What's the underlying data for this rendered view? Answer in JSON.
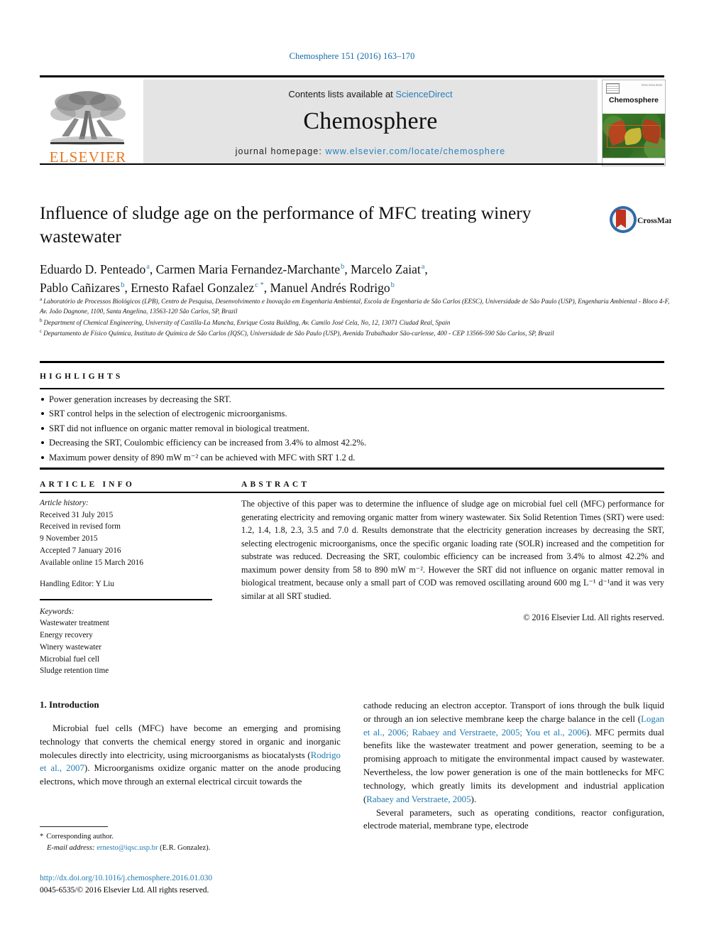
{
  "running_head": "Chemosphere 151 (2016) 163–170",
  "masthead": {
    "contents_prefix": "Contents lists available at ",
    "sciencedirect": "ScienceDirect",
    "journal_name": "Chemosphere",
    "homepage_prefix": "journal homepage: ",
    "homepage_url": "www.elsevier.com/locate/chemosphere",
    "publisher": "ELSEVIER",
    "cover_title": "Chemosphere",
    "cover_issn": "ISSN 0045-6535"
  },
  "article": {
    "title": "Influence of sludge age on the performance of MFC treating winery wastewater",
    "authors": [
      {
        "name": "Eduardo D. Penteado",
        "marks": "a",
        "sep": ", "
      },
      {
        "name": "Carmen Maria Fernandez-Marchante",
        "marks": "b",
        "sep": ", "
      },
      {
        "name": "Marcelo Zaiat",
        "marks": "a",
        "sep": ","
      },
      {
        "name": "Pablo Cañizares",
        "marks": "b",
        "sep": ", "
      },
      {
        "name": "Ernesto Rafael Gonzalez",
        "marks": "c *",
        "sep": ", "
      },
      {
        "name": "Manuel Andrés Rodrigo",
        "marks": "b",
        "sep": ""
      }
    ],
    "affiliations": [
      {
        "mark": "a",
        "text": "Laboratório de Processos Biológicos (LPB), Centro de Pesquisa, Desenvolvimento e Inovação em Engenharia Ambiental, Escola de Engenharia de São Carlos (EESC), Universidade de São Paulo (USP), Engenharia Ambiental - Bloco 4-F, Av. João Dagnone, 1100, Santa Angelina, 13563-120 São Carlos, SP, Brazil"
      },
      {
        "mark": "b",
        "text": "Department of Chemical Engineering, University of Castilla-La Mancha, Enrique Costa Building, Av. Camilo José Cela, No, 12, 13071 Ciudad Real, Spain"
      },
      {
        "mark": "c",
        "text": "Departamento de Físico Química, Instituto de Química de São Carlos (IQSC), Universidade de São Paulo (USP), Avenida Trabalhador São-carlense, 400 - CEP 13566-590 São Carlos, SP, Brazil"
      }
    ]
  },
  "highlights": {
    "label": "HIGHLIGHTS",
    "items": [
      "Power generation increases by decreasing the SRT.",
      "SRT control helps in the selection of electrogenic microorganisms.",
      "SRT did not influence on organic matter removal in biological treatment.",
      "Decreasing the SRT, Coulombic efficiency can be increased from 3.4% to almost 42.2%.",
      "Maximum power density of 890 mW m⁻² can be achieved with MFC with SRT 1.2 d."
    ]
  },
  "article_info": {
    "label": "ARTICLE INFO",
    "history_heading": "Article history:",
    "history": [
      "Received 31 July 2015",
      "Received in revised form",
      "9 November 2015",
      "Accepted 7 January 2016",
      "Available online 15 March 2016"
    ],
    "handling_editor": "Handling Editor: Y Liu",
    "keywords_heading": "Keywords:",
    "keywords": [
      "Wastewater treatment",
      "Energy recovery",
      "Winery wastewater",
      "Microbial fuel cell",
      "Sludge retention time"
    ]
  },
  "abstract": {
    "label": "ABSTRACT",
    "text": "The objective of this paper was to determine the influence of sludge age on microbial fuel cell (MFC) performance for generating electricity and removing organic matter from winery wastewater. Six Solid Retention Times (SRT) were used: 1.2, 1.4, 1.8, 2.3, 3.5 and 7.0 d. Results demonstrate that the electricity generation increases by decreasing the SRT, selecting electrogenic microorganisms, once the specific organic loading rate (SOLR) increased and the competition for substrate was reduced. Decreasing the SRT, coulombic efficiency can be increased from 3.4% to almost 42.2% and maximum power density from 58 to 890 mW m⁻². However the SRT did not influence on organic matter removal in biological treatment, because only a small part of COD was removed oscillating around 600 mg L⁻¹ d⁻¹and it was very similar at all SRT studied.",
    "copyright": "© 2016 Elsevier Ltd. All rights reserved."
  },
  "introduction": {
    "heading": "1. Introduction",
    "left_paragraph_a": "Microbial fuel cells (MFC) have become an emerging and promising technology that converts the chemical energy stored in organic and inorganic molecules directly into electricity, using microorganisms as biocatalysts (",
    "left_ref_a": "Rodrigo et al., 2007",
    "left_paragraph_b": "). Microorganisms oxidize organic matter on the anode producing electrons, which move through an external electrical circuit towards the",
    "right_paragraph_a": "cathode reducing an electron acceptor. Transport of ions through the bulk liquid or through an ion selective membrane keep the charge balance in the cell (",
    "right_ref_a": "Logan et al., 2006; Rabaey and Verstraete, 2005; You et al., 2006",
    "right_paragraph_b": "). MFC permits dual benefits like the wastewater treatment and power generation, seeming to be a promising approach to mitigate the environmental impact caused by wastewater. Nevertheless, the low power generation is one of the main bottlenecks for MFC technology, which greatly limits its development and industrial application (",
    "right_ref_b": "Rabaey and Verstraete, 2005",
    "right_paragraph_c": ").",
    "right_paragraph_d": "Several parameters, such as operating conditions, reactor configuration, electrode material, membrane type, electrode"
  },
  "footnote": {
    "corresponding_marker": "*",
    "corresponding_label": "Corresponding author.",
    "email_label": "E-mail address:",
    "email": "ernesto@iqsc.usp.br",
    "email_owner": "(E.R. Gonzalez)."
  },
  "doi": {
    "url": "http://dx.doi.org/10.1016/j.chemosphere.2016.01.030",
    "issn_line": "0045-6535/© 2016 Elsevier Ltd. All rights reserved."
  },
  "crossmark": {
    "label": "CrossMark"
  },
  "colors": {
    "link": "#1f7bb0",
    "elsevier_orange": "#e87722",
    "band_gray": "#e4e4e4"
  }
}
